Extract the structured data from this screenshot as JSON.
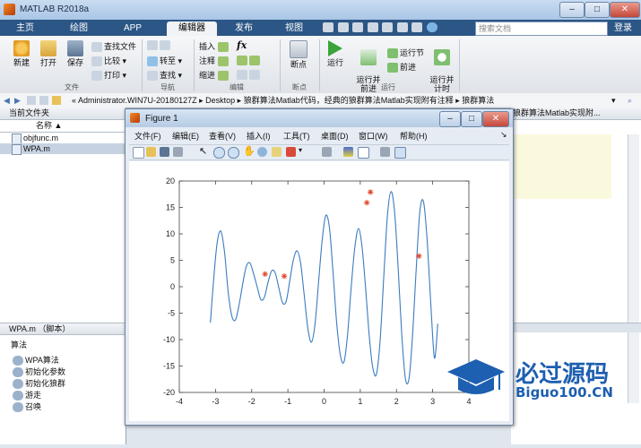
{
  "window": {
    "title": "MATLAB R2018a",
    "minimize": "–",
    "maximize": "□",
    "close": "✕"
  },
  "tabs": [
    {
      "label": "主页",
      "active": false
    },
    {
      "label": "绘图",
      "active": false
    },
    {
      "label": "APP",
      "active": false
    },
    {
      "label": "编辑器",
      "active": true
    },
    {
      "label": "发布",
      "active": false
    },
    {
      "label": "视图",
      "active": false
    }
  ],
  "search": {
    "placeholder": "搜索文档"
  },
  "signin": "登录",
  "toolstrip": {
    "file": {
      "new": "新建",
      "open": "打开",
      "save": "保存",
      "find_files": "查找文件",
      "compare": "比较",
      "print": "打印",
      "group": "文件"
    },
    "navigate": {
      "goto": "转至",
      "find": "查找",
      "group": "导航"
    },
    "edit": {
      "insert": "插入",
      "comment": "注释",
      "indent": "缩进",
      "fx": "fx",
      "group": "编辑"
    },
    "breakpoints": {
      "label": "断点",
      "group": "断点"
    },
    "run": {
      "run": "运行",
      "run_advance": "运行并\n前进",
      "run_section": "运行节",
      "advance": "前进",
      "run_time": "运行并\n计时",
      "group": "运行"
    }
  },
  "address": {
    "path": [
      "«",
      "Administrator.WIN7U-20180127Z",
      "Desktop",
      "狼群算法Matlab代码，经典的狼群算法Matlab实现附有注释",
      "狼群算法"
    ]
  },
  "current_folder": {
    "title": "当前文件夹",
    "column": "名称 ▲",
    "files": [
      {
        "name": "objfunc.m",
        "selected": false
      },
      {
        "name": "WPA.m",
        "selected": true
      }
    ]
  },
  "details": {
    "title": "WPA.m （脚本）",
    "heading": "算法",
    "items": [
      "WPA算法",
      "初始化参数",
      "初始化狼群",
      "游走",
      "召唤"
    ]
  },
  "editor_tab": "狼群算法Matlab实现附...",
  "figure": {
    "title": "Figure 1",
    "menu": [
      "文件(F)",
      "编辑(E)",
      "查看(V)",
      "插入(I)",
      "工具(T)",
      "桌面(D)",
      "窗口(W)",
      "帮助(H)"
    ],
    "tools": [
      "new-figure",
      "open-file",
      "save",
      "print",
      "pointer",
      "zoom-in",
      "zoom-out",
      "pan",
      "rotate-3d",
      "data-cursor",
      "brush",
      "link-plot",
      "colorbar",
      "legend",
      "hide-plot-tools",
      "show-plot-tools"
    ]
  },
  "chart_data": {
    "type": "line",
    "title": "",
    "xlabel": "",
    "ylabel": "",
    "xlim": [
      -4,
      4
    ],
    "ylim": [
      -20,
      20
    ],
    "xticks": [
      -4,
      -3,
      -2,
      -1,
      0,
      1,
      2,
      3,
      4
    ],
    "yticks": [
      20,
      15,
      10,
      5,
      0,
      -5,
      -10,
      -15,
      -20
    ],
    "grid": false,
    "series": [
      {
        "style": "line",
        "color": "#3a7cc0",
        "x": [
          -3.14,
          -3.05,
          -2.95,
          -2.85,
          -2.75,
          -2.65,
          -2.55,
          -2.45,
          -2.35,
          -2.25,
          -2.15,
          -2.05,
          -1.95,
          -1.85,
          -1.75,
          -1.65,
          -1.55,
          -1.45,
          -1.35,
          -1.25,
          -1.15,
          -1.05,
          -0.95,
          -0.85,
          -0.75,
          -0.65,
          -0.55,
          -0.45,
          -0.35,
          -0.25,
          -0.15,
          -0.05,
          0.05,
          0.15,
          0.25,
          0.35,
          0.45,
          0.55,
          0.65,
          0.75,
          0.85,
          0.95,
          1.05,
          1.15,
          1.25,
          1.35,
          1.45,
          1.55,
          1.65,
          1.75,
          1.85,
          1.95,
          2.05,
          2.15,
          2.25,
          2.35,
          2.45,
          2.55,
          2.65,
          2.75,
          2.85,
          2.95,
          3.05,
          3.14
        ],
        "y": [
          -6.8,
          1.5,
          8.5,
          10.5,
          6.5,
          -1.0,
          -5.5,
          -6.3,
          -3.5,
          0.5,
          3.8,
          4.5,
          2.5,
          0.0,
          -2.4,
          -2.0,
          0.8,
          3.0,
          2.6,
          -0.2,
          -3.0,
          -2.8,
          1.0,
          5.0,
          6.8,
          4.5,
          -1.5,
          -7.8,
          -10.5,
          -7.0,
          1.0,
          9.0,
          13.5,
          11.0,
          2.5,
          -7.0,
          -13.0,
          -14.2,
          -9.0,
          0.0,
          7.5,
          11.0,
          7.5,
          -0.5,
          -9.5,
          -15.5,
          -16.5,
          -10.0,
          2.0,
          13.5,
          18.0,
          14.0,
          3.0,
          -9.5,
          -17.5,
          -17.2,
          -8.5,
          4.0,
          14.5,
          16.0,
          8.5,
          -3.5,
          -13.5,
          -7.0
        ]
      },
      {
        "style": "markers",
        "marker": "*",
        "color": "#e0462a",
        "x": [
          -1.63,
          -1.1,
          1.18,
          1.28,
          2.62
        ],
        "y": [
          2.4,
          2.0,
          15.9,
          17.9,
          5.8
        ]
      }
    ]
  },
  "watermark": {
    "brand": "必过源码",
    "url": "Biguo100.CN"
  }
}
